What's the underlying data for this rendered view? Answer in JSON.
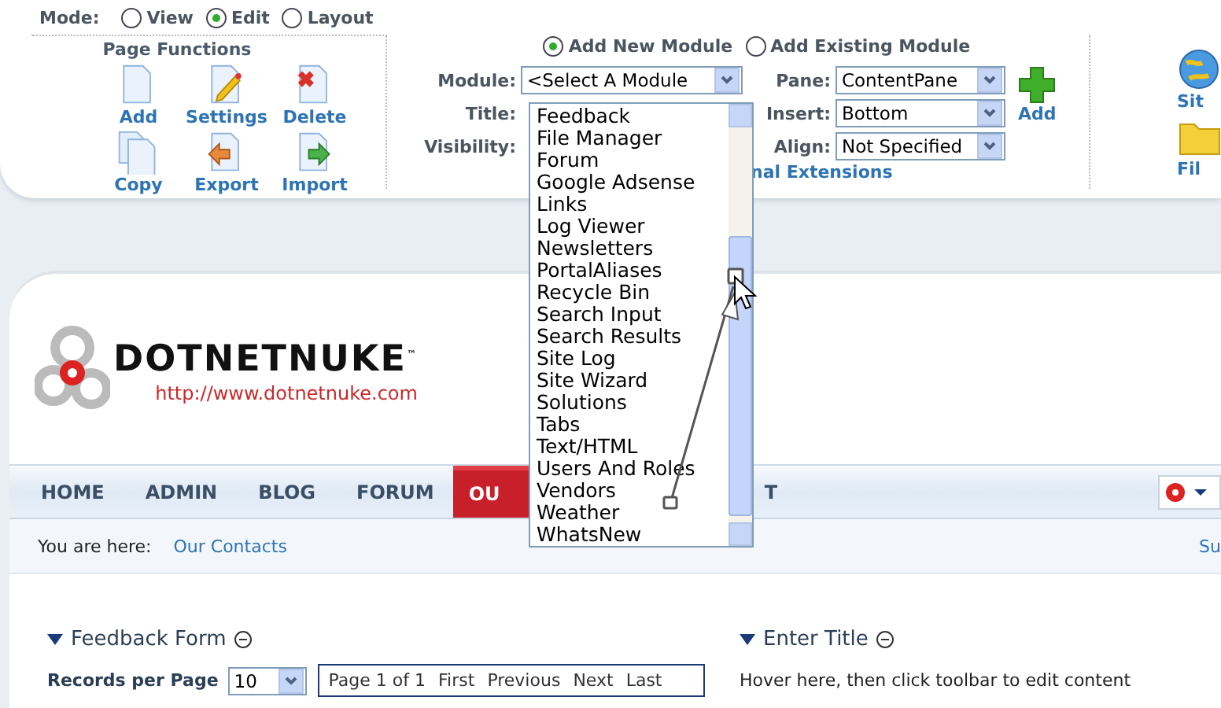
{
  "mode": {
    "label": "Mode:",
    "options": [
      {
        "label": "View",
        "selected": false
      },
      {
        "label": "Edit",
        "selected": true
      },
      {
        "label": "Layout",
        "selected": false
      }
    ]
  },
  "page_functions": {
    "title": "Page Functions",
    "actions": [
      {
        "label": "Add",
        "kind": "add"
      },
      {
        "label": "Settings",
        "kind": "settings"
      },
      {
        "label": "Delete",
        "kind": "delete"
      },
      {
        "label": "Copy",
        "kind": "copy"
      },
      {
        "label": "Export",
        "kind": "export"
      },
      {
        "label": "Import",
        "kind": "import"
      }
    ]
  },
  "module_panel": {
    "sources": [
      {
        "label": "Add New Module",
        "selected": true
      },
      {
        "label": "Add Existing Module",
        "selected": false
      }
    ],
    "fields_left": [
      {
        "label": "Module:",
        "value": "<Select A Module"
      },
      {
        "label": "Title:"
      },
      {
        "label": "Visibility:"
      }
    ],
    "fields_right": [
      {
        "label": "Pane:",
        "value": "ContentPane"
      },
      {
        "label": "Insert:",
        "value": "Bottom"
      },
      {
        "label": "Align:",
        "value": "Not Specified"
      }
    ],
    "add_label": "Add",
    "extensions_link": "nal Extensions"
  },
  "dropdown": {
    "options": [
      {
        "label": "Feedback",
        "selected": false
      },
      {
        "label": "File Manager",
        "selected": false
      },
      {
        "label": "Forum",
        "selected": false
      },
      {
        "label": "Google Adsense",
        "selected": false
      },
      {
        "label": "Links",
        "selected": false
      },
      {
        "label": "Log Viewer",
        "selected": false
      },
      {
        "label": "Newsletters",
        "selected": false
      },
      {
        "label": "PortalAliases",
        "selected": false
      },
      {
        "label": "Recycle Bin",
        "selected": false
      },
      {
        "label": "Search Input",
        "selected": false
      },
      {
        "label": "Search Results",
        "selected": false
      },
      {
        "label": "Site Log",
        "selected": false
      },
      {
        "label": "Site Wizard",
        "selected": false
      },
      {
        "label": "Solutions",
        "selected": false
      },
      {
        "label": "Tabs",
        "selected": false
      },
      {
        "label": "Text/HTML",
        "selected": false
      },
      {
        "label": "Users And Roles",
        "selected": false
      },
      {
        "label": "Vendors",
        "selected": false
      },
      {
        "label": "Weather",
        "selected": false
      },
      {
        "label": "WhatsNew",
        "selected": false
      }
    ]
  },
  "right_tools": [
    {
      "label": "Sit",
      "kind": "site"
    },
    {
      "label": "Fil",
      "kind": "files"
    }
  ],
  "site": {
    "logo_text": "DOTNETNUKE$^{™}$",
    "logo_url": "http://www.dotnetnuke.com",
    "nav": [
      {
        "label": "HOME",
        "selected": false
      },
      {
        "label": "ADMIN",
        "selected": false
      },
      {
        "label": "BLOG",
        "selected": false
      },
      {
        "label": "FORUM",
        "selected": false
      },
      {
        "label": "OU",
        "selected": true
      },
      {
        "label": "T",
        "selected": false
      }
    ],
    "breadcrumb": {
      "label": "You are here:",
      "link": "Our Contacts",
      "right": "Su"
    },
    "left_module": {
      "title": "Feedback Form",
      "records_label": "Records per Page",
      "records_value": "10",
      "pager": [
        "Page 1 of 1",
        "First",
        "Previous",
        "Next",
        "Last"
      ]
    },
    "right_module": {
      "title": "Enter Title",
      "body": "Hover here, then click toolbar to edit content"
    }
  }
}
